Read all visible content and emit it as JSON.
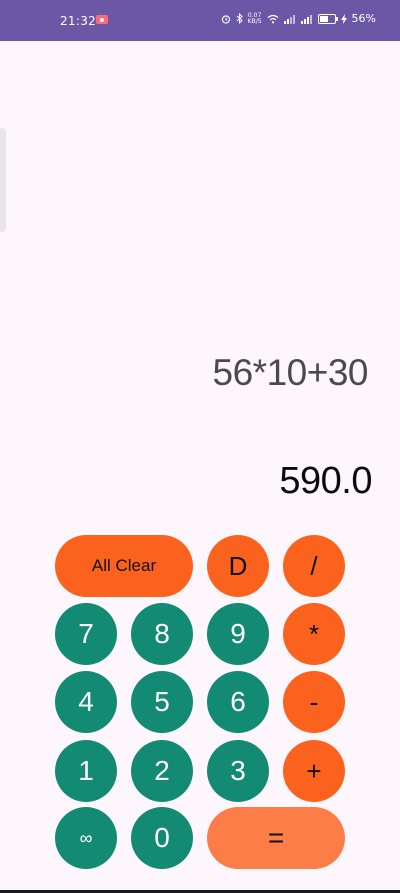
{
  "status_bar": {
    "time": "21:32",
    "net_speed_value": "0.07",
    "net_speed_unit": "KB/S",
    "battery_percent": "56%",
    "background_color": "#6a58a6"
  },
  "display": {
    "expression": "56*10+30",
    "result": "590.0"
  },
  "keys": {
    "all_clear": "All Clear",
    "delete": "D",
    "divide": "/",
    "seven": "7",
    "eight": "8",
    "nine": "9",
    "multiply": "*",
    "four": "4",
    "five": "5",
    "six": "6",
    "minus": "-",
    "one": "1",
    "two": "2",
    "three": "3",
    "plus": "+",
    "infinity": "∞",
    "zero": "0",
    "equals": "="
  },
  "colors": {
    "number_key": "#128a74",
    "operator_key": "#fb621d",
    "equals_key": "#fd7d48",
    "background": "#fdf7fd"
  },
  "icons": [
    "alarm-icon",
    "bluetooth-icon",
    "wifi-icon",
    "signal-icon",
    "battery-icon",
    "charging-icon",
    "screen-record-icon"
  ]
}
